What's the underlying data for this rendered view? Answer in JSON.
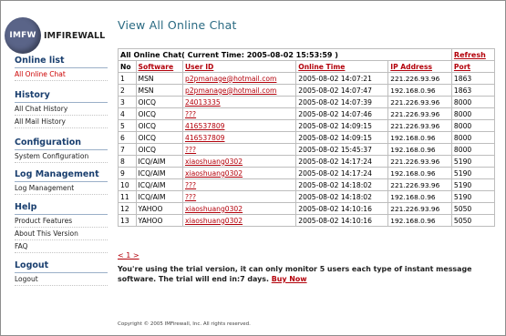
{
  "logo": {
    "badge": "IMFW",
    "name": "IMFIREWALL"
  },
  "sidebar": {
    "sections": [
      {
        "title": "Online list",
        "items": [
          {
            "label": "All Online Chat",
            "active": true
          }
        ]
      },
      {
        "title": "History",
        "items": [
          {
            "label": "All Chat History"
          },
          {
            "label": "All Mail History"
          }
        ]
      },
      {
        "title": "Configuration",
        "items": [
          {
            "label": "System Configuration"
          }
        ]
      },
      {
        "title": "Log Management",
        "items": [
          {
            "label": "Log Management"
          }
        ]
      },
      {
        "title": "Help",
        "items": [
          {
            "label": "Product Features"
          },
          {
            "label": "About This Version"
          },
          {
            "label": "FAQ"
          }
        ]
      },
      {
        "title": "Logout",
        "items": [
          {
            "label": "Logout"
          }
        ]
      }
    ]
  },
  "page": {
    "title": "View All Online Chat"
  },
  "table": {
    "caption": "All Online Chat( Current Time: 2005-08-02 15:53:59 )",
    "refresh_label": "Refresh",
    "headers": {
      "no": "No",
      "software": "Software",
      "user_id": "User ID",
      "online_time": "Online Time",
      "ip": "IP Address",
      "port": "Port"
    },
    "rows": [
      {
        "no": "1",
        "software": "MSN",
        "user_id": "p2pmanage@hotmail.com",
        "online_time": "2005-08-02 14:07:21",
        "ip": "221.226.93.96",
        "port": "1863"
      },
      {
        "no": "2",
        "software": "MSN",
        "user_id": "p2pmanage@hotmail.com",
        "online_time": "2005-08-02 14:07:47",
        "ip": "192.168.0.96",
        "port": "1863"
      },
      {
        "no": "3",
        "software": "OICQ",
        "user_id": "24013335",
        "online_time": "2005-08-02 14:07:39",
        "ip": "221.226.93.96",
        "port": "8000"
      },
      {
        "no": "4",
        "software": "OICQ",
        "user_id": "???",
        "online_time": "2005-08-02 14:07:46",
        "ip": "221.226.93.96",
        "port": "8000"
      },
      {
        "no": "5",
        "software": "OICQ",
        "user_id": "416537809",
        "online_time": "2005-08-02 14:09:15",
        "ip": "221.226.93.96",
        "port": "8000"
      },
      {
        "no": "6",
        "software": "OICQ",
        "user_id": "416537809",
        "online_time": "2005-08-02 14:09:15",
        "ip": "192.168.0.96",
        "port": "8000"
      },
      {
        "no": "7",
        "software": "OICQ",
        "user_id": "???",
        "online_time": "2005-08-02 15:45:37",
        "ip": "192.168.0.96",
        "port": "8000"
      },
      {
        "no": "8",
        "software": "ICQ/AIM",
        "user_id": "xiaoshuang0302",
        "online_time": "2005-08-02 14:17:24",
        "ip": "221.226.93.96",
        "port": "5190"
      },
      {
        "no": "9",
        "software": "ICQ/AIM",
        "user_id": "xiaoshuang0302",
        "online_time": "2005-08-02 14:17:24",
        "ip": "192.168.0.96",
        "port": "5190"
      },
      {
        "no": "10",
        "software": "ICQ/AIM",
        "user_id": "???",
        "online_time": "2005-08-02 14:18:02",
        "ip": "221.226.93.96",
        "port": "5190"
      },
      {
        "no": "11",
        "software": "ICQ/AIM",
        "user_id": "???",
        "online_time": "2005-08-02 14:18:02",
        "ip": "192.168.0.96",
        "port": "5190"
      },
      {
        "no": "12",
        "software": "YAHOO",
        "user_id": "xiaoshuang0302",
        "online_time": "2005-08-02 14:10:16",
        "ip": "221.226.93.96",
        "port": "5050"
      },
      {
        "no": "13",
        "software": "YAHOO",
        "user_id": "xiaoshuang0302",
        "online_time": "2005-08-02 14:10:16",
        "ip": "192.168.0.96",
        "port": "5050"
      }
    ]
  },
  "pager": {
    "label": "< 1 >"
  },
  "trial": {
    "message": "You're using the trial version, it can only monitor 5 users each type of instant message software. The trial will end in:7 days.",
    "buy_label": "Buy Now"
  },
  "footer": {
    "copyright": "Copyright © 2005 IMFirewall, Inc. All rights reserved."
  },
  "colors": {
    "accent_red": "#b3000a",
    "title_teal": "#2a6a82",
    "section_blue": "#1a3f6f"
  }
}
